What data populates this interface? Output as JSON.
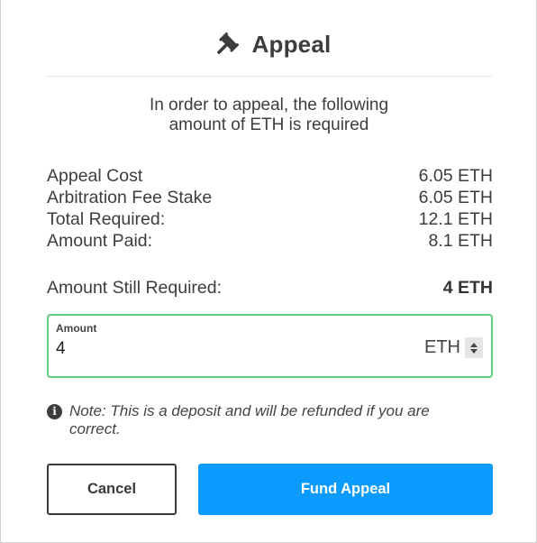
{
  "header": {
    "title": "Appeal",
    "icon": "gavel-icon"
  },
  "subtitle": {
    "line1": "In order to appeal, the following",
    "line2": "amount of ETH is required"
  },
  "summary": [
    {
      "label": "Appeal Cost",
      "value": "6.05 ETH"
    },
    {
      "label": "Arbitration Fee Stake",
      "value": "6.05 ETH"
    },
    {
      "label": "Total Required:",
      "value": "12.1 ETH"
    },
    {
      "label": "Amount Paid:",
      "value": "8.1 ETH"
    }
  ],
  "still_required": {
    "label": "Amount Still Required:",
    "value": "4 ETH"
  },
  "amount_field": {
    "label": "Amount",
    "value": "4",
    "unit": "ETH"
  },
  "note": {
    "icon": "info-icon",
    "text": "Note: This is a deposit and will be refunded if you are correct."
  },
  "buttons": {
    "cancel": "Cancel",
    "fund": "Fund Appeal"
  },
  "colors": {
    "primary": "#0b9bff",
    "input_border": "#5fcf7c",
    "text": "#3d3d3d"
  }
}
